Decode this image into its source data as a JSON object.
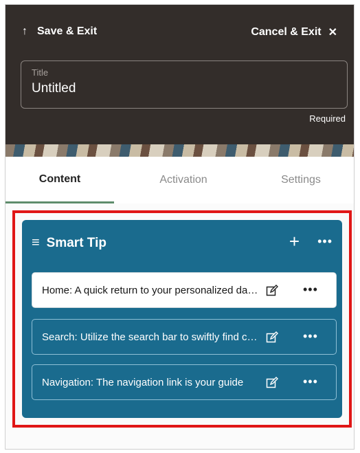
{
  "header": {
    "save_exit_label": "Save & Exit",
    "cancel_exit_label": "Cancel & Exit",
    "title_label": "Title",
    "title_value": "Untitled",
    "required_text": "Required"
  },
  "tabs": [
    {
      "label": "Content",
      "active": true
    },
    {
      "label": "Activation",
      "active": false
    },
    {
      "label": "Settings",
      "active": false
    }
  ],
  "panel": {
    "title": "Smart Tip",
    "items": [
      {
        "text": "Home: A quick return to your personalized dashboard"
      },
      {
        "text": "Search: Utilize the search bar to swiftly find content"
      },
      {
        "text": "Navigation: The navigation link is your guide"
      }
    ]
  },
  "colors": {
    "header_bg": "#332d2a",
    "panel_bg": "#1a6b8e",
    "highlight_border": "#e01616",
    "active_tab_underline": "#5e8c6b"
  },
  "icons": {
    "save": "arrow-up-icon",
    "cancel": "close-icon",
    "drag": "hamburger-icon",
    "add": "plus-icon",
    "more": "ellipsis-icon",
    "edit": "edit-icon"
  }
}
